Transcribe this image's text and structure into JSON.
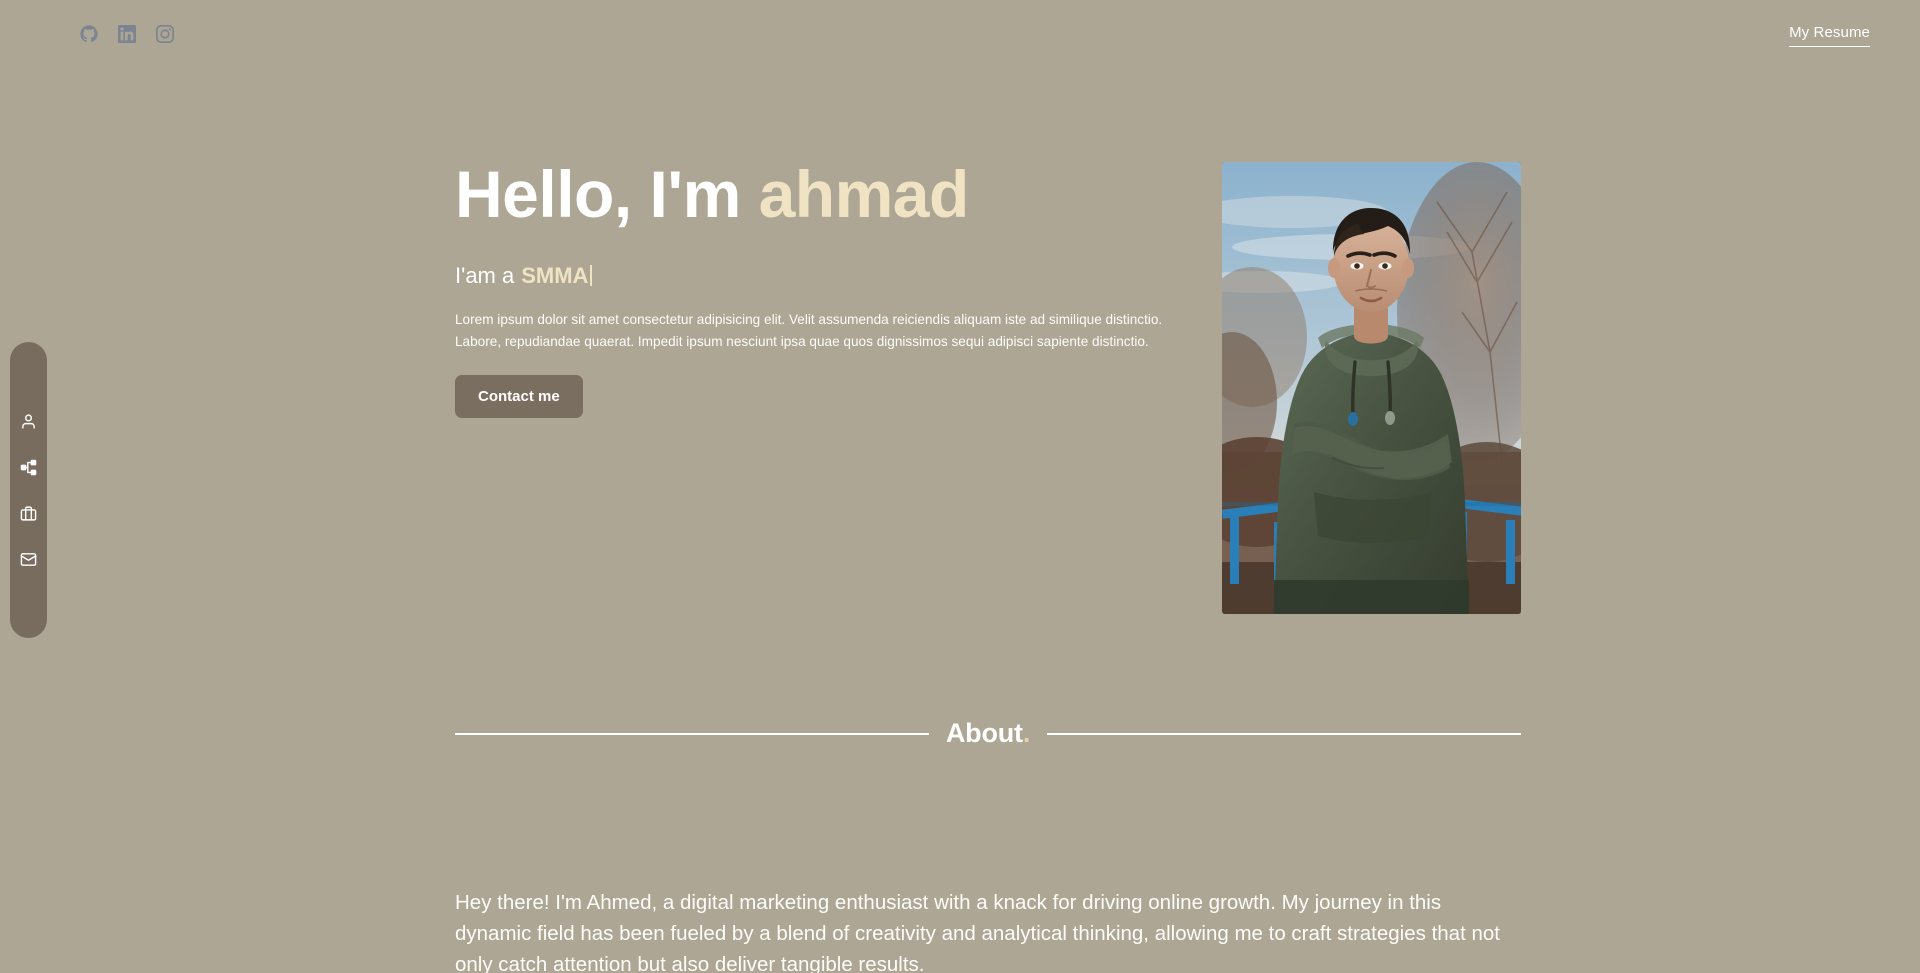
{
  "page": {
    "background_color": "#ada694",
    "accent_color": "#efe3c4",
    "sidebar_color": "#786c5e",
    "button_color": "#7a6e60",
    "social_icon_color": "#7b8490"
  },
  "topbar": {
    "socials": [
      {
        "name": "github-icon",
        "label": "GitHub"
      },
      {
        "name": "linkedin-icon",
        "label": "LinkedIn"
      },
      {
        "name": "instagram-icon",
        "label": "Instagram"
      }
    ],
    "resume_label": "My Resume"
  },
  "sidenav": {
    "items": [
      {
        "name": "sidebar-item-about",
        "icon": "user-icon",
        "label": "About"
      },
      {
        "name": "sidebar-item-skills",
        "icon": "git-branch-icon",
        "label": "Skills"
      },
      {
        "name": "sidebar-item-work",
        "icon": "briefcase-icon",
        "label": "Work"
      },
      {
        "name": "sidebar-item-contact",
        "icon": "mail-icon",
        "label": "Contact"
      }
    ]
  },
  "hero": {
    "greeting": "Hello, I'm ",
    "name": "ahmad",
    "role_prefix": "I'am a",
    "role": "SMMA",
    "description": "Lorem ipsum dolor sit amet consectetur adipisicing elit. Velit assumenda reiciendis aliquam iste ad similique distinctio. Labore, repudiandae quaerat. Impedit ipsum nesciunt ipsa quae quos dignissimos sequi adipisci sapiente distinctio.",
    "cta_label": "Contact me",
    "photo_alt": "Portrait of a young man in a green hoodie with arms crossed, standing on a bridge with blue railings"
  },
  "about": {
    "heading": "About",
    "heading_dot": ".",
    "body": "Hey there! I'm Ahmed, a digital marketing enthusiast with a knack for driving online growth. My journey in this dynamic field has been fueled by a blend of creativity and analytical thinking, allowing me to craft strategies that not only catch attention but also deliver tangible results."
  }
}
